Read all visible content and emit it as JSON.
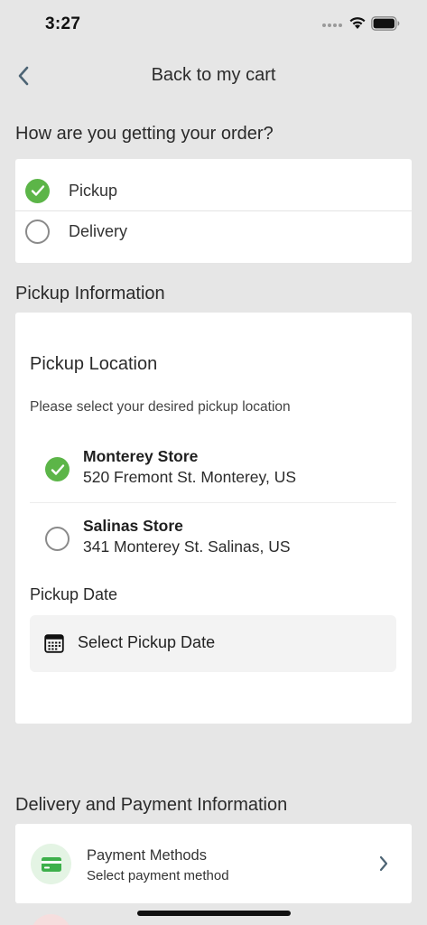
{
  "status_bar": {
    "time": "3:27"
  },
  "header": {
    "title": "Back to my cart"
  },
  "fulfillment": {
    "heading": "How are you getting your order?",
    "options": [
      {
        "label": "Pickup",
        "selected": true
      },
      {
        "label": "Delivery",
        "selected": false
      }
    ]
  },
  "pickup_info": {
    "heading": "Pickup Information",
    "location_title": "Pickup Location",
    "location_subtitle": "Please select your desired pickup location",
    "stores": [
      {
        "name": "Monterey Store",
        "address": "520 Fremont St. Monterey, US",
        "selected": true
      },
      {
        "name": "Salinas Store",
        "address": "341 Monterey St. Salinas, US",
        "selected": false
      }
    ],
    "date_label": "Pickup Date",
    "date_placeholder": "Select Pickup Date"
  },
  "delivery_payment": {
    "heading": "Delivery and Payment Information",
    "payment_title": "Payment Methods",
    "payment_subtitle": "Select payment method"
  },
  "colors": {
    "accent_green": "#5cb548",
    "background": "#e6e6e6",
    "card": "#ffffff",
    "payment_icon_bg": "#e4f4e4"
  },
  "icons": {
    "back": "chevron-left-icon",
    "check": "check-icon",
    "calendar": "calendar-icon",
    "payment": "credit-card-icon",
    "row_arrow": "chevron-right-icon",
    "wifi": "wifi-icon",
    "battery": "battery-icon"
  }
}
